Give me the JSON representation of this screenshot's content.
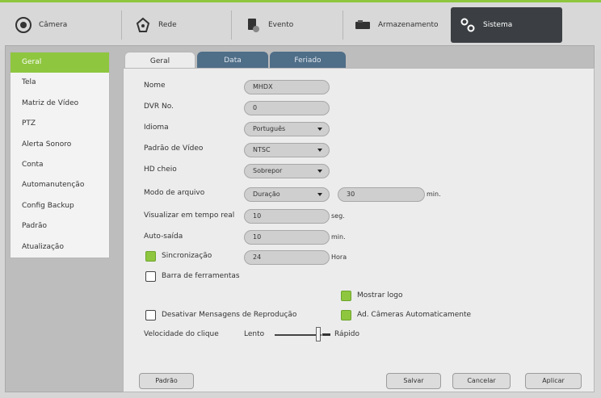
{
  "topnav": {
    "items": [
      {
        "label": "Câmera"
      },
      {
        "label": "Rede"
      },
      {
        "label": "Evento"
      },
      {
        "label": "Armazenamento"
      },
      {
        "label": "Sistema"
      }
    ]
  },
  "sidebar": {
    "items": [
      "Geral",
      "Tela",
      "Matriz de Vídeo",
      "PTZ",
      "Alerta Sonoro",
      "Conta",
      "Automanutenção",
      "Config Backup",
      "Padrão",
      "Atualização"
    ]
  },
  "tabs": [
    "Geral",
    "Data",
    "Feriado"
  ],
  "form": {
    "nome_label": "Nome",
    "nome_value": "MHDX",
    "dvr_label": "DVR No.",
    "dvr_value": "0",
    "idioma_label": "Idioma",
    "idioma_value": "Português",
    "padrao_video_label": "Padrão de Vídeo",
    "padrao_video_value": "NTSC",
    "hd_label": "HD cheio",
    "hd_value": "Sobrepor",
    "modo_label": "Modo de arquivo",
    "modo_value": "Duração",
    "modo_min_value": "30",
    "modo_unit": "min.",
    "visualizar_label": "Visualizar em tempo real",
    "visualizar_value": "10",
    "visualizar_unit": "seg.",
    "auto_label": "Auto-saída",
    "auto_value": "10",
    "auto_unit": "min.",
    "sinc_label": "Sincronização",
    "sinc_value": "24",
    "sinc_unit": "Hora",
    "barra_label": "Barra de ferramentas",
    "mostrar_logo_label": "Mostrar logo",
    "desativar_label": "Desativar Mensagens de Reprodução",
    "ad_cameras_label": "Ad. Câmeras Automaticamente",
    "velocidade_label": "Velocidade do clique",
    "lento_label": "Lento",
    "rapido_label": "Rápido",
    "slider_value_fraction": 0.9
  },
  "checkboxes": {
    "sincronizacao": true,
    "barra": false,
    "mostrar_logo": true,
    "desativar": false,
    "ad_cameras": true
  },
  "buttons": {
    "padrao": "Padrão",
    "salvar": "Salvar",
    "cancelar": "Cancelar",
    "aplicar": "Aplicar"
  },
  "colors": {
    "accent_green": "#8ec63f",
    "tab_blue": "#4f6e88",
    "nav_active": "#3b3f43"
  }
}
